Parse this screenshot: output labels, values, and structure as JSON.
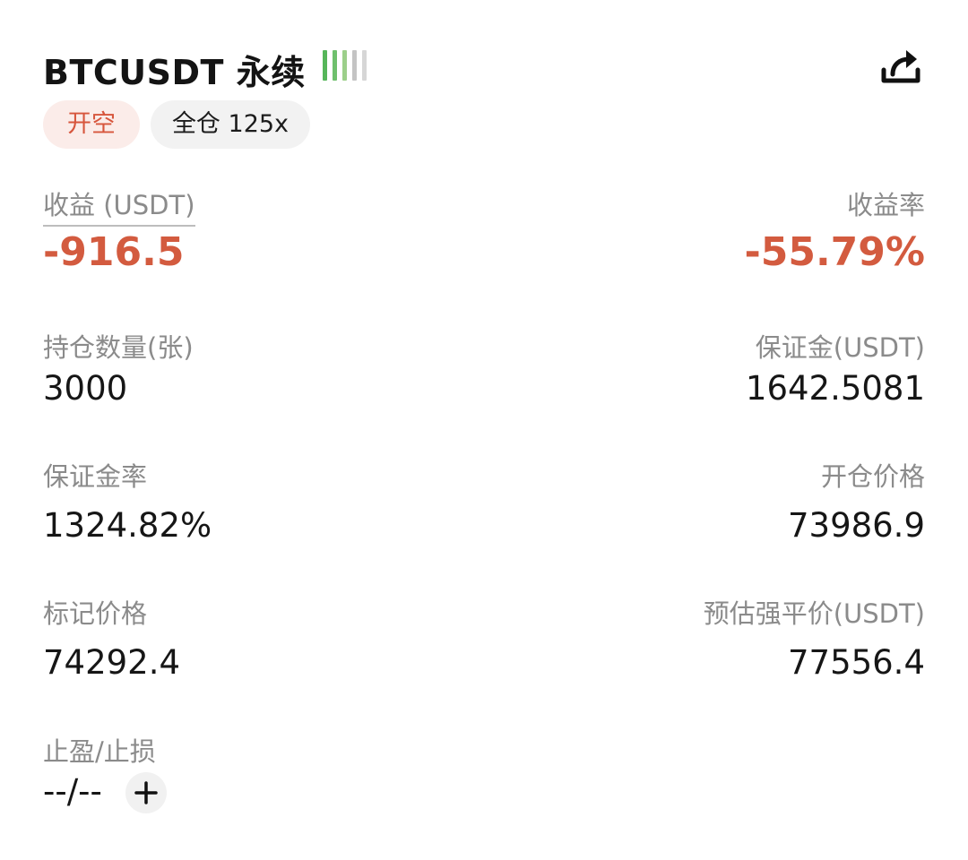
{
  "header": {
    "title": "BTCUSDT 永续",
    "signal_bar_colors": [
      "#56b65a",
      "#6fc06d",
      "#9ccf8a",
      "#c4c4c4",
      "#d6d6d6"
    ],
    "share_icon": "share-icon"
  },
  "tags": {
    "side": "开空",
    "margin_mode": "全仓 125x"
  },
  "colors": {
    "loss": "#d35b3f",
    "label": "#8b8b8b",
    "value": "#161616"
  },
  "pnl": {
    "label": "收益 (USDT)",
    "value": "-916.5"
  },
  "roe": {
    "label": "收益率",
    "value": "-55.79%"
  },
  "position_size": {
    "label": "持仓数量(张)",
    "value": "3000"
  },
  "margin": {
    "label": "保证金(USDT)",
    "value": "1642.5081"
  },
  "margin_ratio": {
    "label": "保证金率",
    "value": "1324.82%"
  },
  "entry_price": {
    "label": "开仓价格",
    "value": "73986.9"
  },
  "mark_price": {
    "label": "标记价格",
    "value": "74292.4"
  },
  "liq_price": {
    "label": "预估强平价(USDT)",
    "value": "77556.4"
  },
  "tp_sl": {
    "label": "止盈/止损",
    "value": "--/--",
    "add_icon": "plus-icon"
  }
}
